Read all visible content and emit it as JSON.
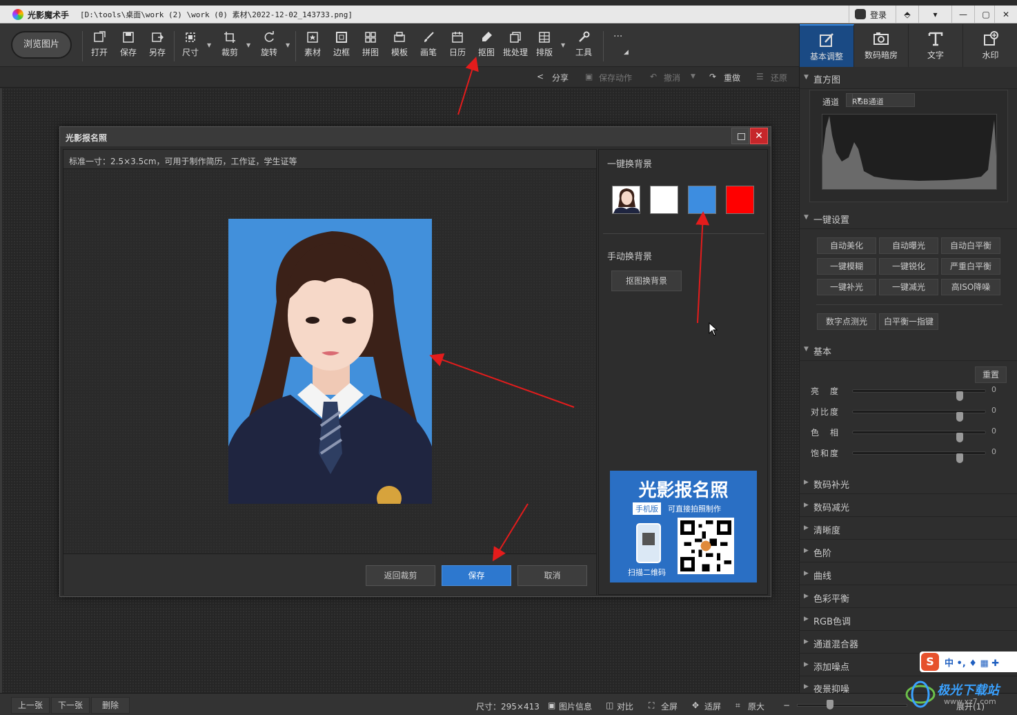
{
  "window": {
    "app_name": "光影魔术手",
    "file_path": "[D:\\tools\\桌面\\work (2) \\work (0) 素材\\2022-12-02_143733.png]",
    "login_label": "登录",
    "controls": [
      "⬘",
      "▾",
      "—",
      "▢",
      "✕"
    ]
  },
  "toolbar": {
    "browse_label": "浏览图片",
    "tools": [
      {
        "label": "打开",
        "icon": "open-icon"
      },
      {
        "label": "保存",
        "icon": "save-icon"
      },
      {
        "label": "另存",
        "icon": "save-as-icon"
      },
      {
        "label": "尺寸",
        "icon": "resize-icon"
      },
      {
        "label": "裁剪",
        "icon": "crop-icon"
      },
      {
        "label": "旋转",
        "icon": "rotate-icon"
      },
      {
        "label": "素材",
        "icon": "material-icon"
      },
      {
        "label": "边框",
        "icon": "border-icon"
      },
      {
        "label": "拼图",
        "icon": "collage-icon"
      },
      {
        "label": "模板",
        "icon": "template-icon"
      },
      {
        "label": "画笔",
        "icon": "brush-icon"
      },
      {
        "label": "日历",
        "icon": "calendar-icon"
      },
      {
        "label": "抠图",
        "icon": "cutout-icon"
      },
      {
        "label": "批处理",
        "icon": "batch-icon"
      },
      {
        "label": "排版",
        "icon": "layout-icon"
      },
      {
        "label": "工具",
        "icon": "tools-icon"
      }
    ],
    "more_label": "···"
  },
  "subbar": {
    "share": "分享",
    "save_action": "保存动作",
    "undo": "撤消",
    "redo": "重做",
    "restore": "还原"
  },
  "dialog": {
    "title": "光影报名照",
    "description": "标准一寸：2.5×3.5cm，可用于制作简历，工作证，学生证等",
    "one_click_bg_label": "一键换背景",
    "manual_bg_label": "手动换背景",
    "manual_bg_button": "抠图换背景",
    "swatches": [
      {
        "name": "original",
        "color": "#ffffff"
      },
      {
        "name": "white",
        "color": "#ffffff"
      },
      {
        "name": "blue",
        "color": "#3d8de0"
      },
      {
        "name": "red",
        "color": "#ff0000"
      }
    ],
    "back_button": "返回裁剪",
    "save_button": "保存",
    "cancel_button": "取消",
    "ad": {
      "headline": "光影报名照",
      "tag": "手机版",
      "tagline": "可直接拍照制作",
      "scan": "扫描二维码"
    }
  },
  "rpanel": {
    "tabs": [
      {
        "label": "基本调整",
        "icon": "basic-adjust-icon"
      },
      {
        "label": "数码暗房",
        "icon": "darkroom-icon"
      },
      {
        "label": "文字",
        "icon": "text-icon"
      },
      {
        "label": "水印",
        "icon": "watermark-icon"
      }
    ],
    "histogram": {
      "title": "直方图",
      "channel_label": "通道",
      "channel_value": "RGB通道"
    },
    "quick": {
      "title": "一键设置",
      "buttons": [
        "自动美化",
        "自动曝光",
        "自动白平衡",
        "一键模糊",
        "一键锐化",
        "严重白平衡",
        "一键补光",
        "一键减光",
        "高ISO降噪"
      ],
      "extra": [
        "数字点测光",
        "白平衡一指键"
      ]
    },
    "basic": {
      "title": "基本",
      "reset": "重置",
      "sliders": [
        {
          "label": "亮　度",
          "value": "0"
        },
        {
          "label": "对比度",
          "value": "0"
        },
        {
          "label": "色　相",
          "value": "0"
        },
        {
          "label": "饱和度",
          "value": "0"
        }
      ]
    },
    "sections": [
      "数码补光",
      "数码减光",
      "清晰度",
      "色阶",
      "曲线",
      "色彩平衡",
      "RGB色调",
      "通道混合器",
      "添加噪点",
      "夜景抑噪"
    ]
  },
  "bottombar": {
    "prev": "上一张",
    "next": "下一张",
    "delete": "删除",
    "size": "尺寸：295×413",
    "info": "图片信息",
    "compare": "对比",
    "fullscreen": "全屏",
    "fit": "适屏",
    "original": "原大",
    "expand": "展开(1)"
  },
  "ime": {
    "label": "中 •, ♦ ▦ ✚"
  },
  "watermark": {
    "title": "极光下载站",
    "url": "www.xz7.com"
  }
}
